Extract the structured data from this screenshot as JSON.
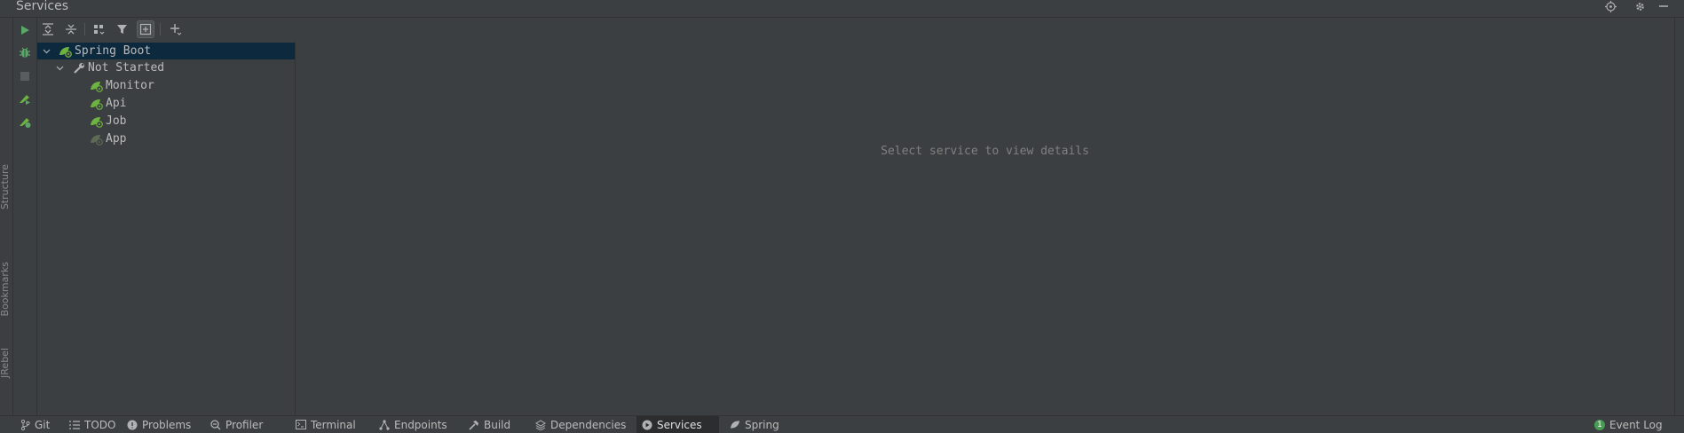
{
  "window": {
    "title": "Services"
  },
  "left_stripe": {
    "tabs": [
      "Structure",
      "Bookmarks",
      "JRebel"
    ]
  },
  "tree": {
    "root": {
      "label": "Spring Boot",
      "expanded": true
    },
    "group": {
      "label": "Not Started",
      "expanded": true
    },
    "items": [
      {
        "label": "Monitor"
      },
      {
        "label": "Api"
      },
      {
        "label": "Job"
      },
      {
        "label": "App"
      }
    ]
  },
  "detail": {
    "placeholder": "Select service to view details"
  },
  "bottom_tabs": [
    {
      "label": "Git",
      "icon": "git-branch-icon"
    },
    {
      "label": "TODO",
      "icon": "todo-list-icon"
    },
    {
      "label": "Problems",
      "icon": "problems-icon"
    },
    {
      "label": "Profiler",
      "icon": "profiler-icon"
    },
    {
      "label": "Terminal",
      "icon": "terminal-icon"
    },
    {
      "label": "Endpoints",
      "icon": "endpoints-icon"
    },
    {
      "label": "Build",
      "icon": "hammer-icon"
    },
    {
      "label": "Dependencies",
      "icon": "layers-icon"
    },
    {
      "label": "Services",
      "icon": "play-circle-icon",
      "active": true
    },
    {
      "label": "Spring",
      "icon": "spring-leaf-icon"
    }
  ],
  "event_log": {
    "label": "Event Log",
    "count": "1"
  },
  "colors": {
    "background": "#3c3f41",
    "selection": "#0d293e",
    "run_green": "#59a869",
    "spring_green": "#6db33f"
  }
}
